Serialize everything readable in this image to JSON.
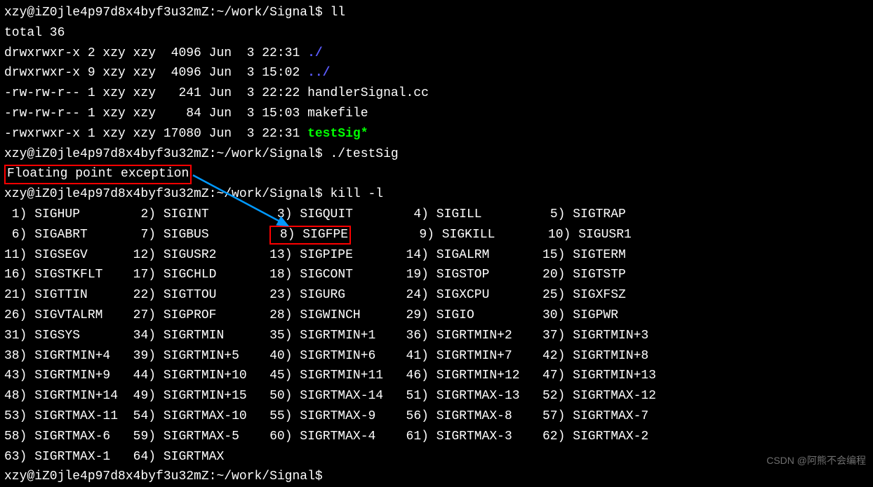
{
  "prompt": {
    "user": "xzy",
    "host": "iZ0jle4p97d8x4byf3u32mZ",
    "cwd": "~/work/Signal",
    "symbol": "$"
  },
  "commands": {
    "c1": "ll",
    "c2": "./testSig",
    "c3": "kill -l"
  },
  "ll_output": {
    "total": "total 36",
    "rows": [
      {
        "perm": "drwxrwxr-x",
        "links": "2",
        "owner": "xzy",
        "group": "xzy",
        "size": "4096",
        "date": "Jun  3 22:31",
        "name": "./",
        "class": "dir"
      },
      {
        "perm": "drwxrwxr-x",
        "links": "9",
        "owner": "xzy",
        "group": "xzy",
        "size": "4096",
        "date": "Jun  3 15:02",
        "name": "../",
        "class": "dir"
      },
      {
        "perm": "-rw-rw-r--",
        "links": "1",
        "owner": "xzy",
        "group": "xzy",
        "size": "241",
        "date": "Jun  3 22:22",
        "name": "handlerSignal.cc",
        "class": ""
      },
      {
        "perm": "-rw-rw-r--",
        "links": "1",
        "owner": "xzy",
        "group": "xzy",
        "size": "84",
        "date": "Jun  3 15:03",
        "name": "makefile",
        "class": ""
      },
      {
        "perm": "-rwxrwxr-x",
        "links": "1",
        "owner": "xzy",
        "group": "xzy",
        "size": "17080",
        "date": "Jun  3 22:31",
        "name": "testSig*",
        "class": "exec"
      }
    ]
  },
  "error_msg": "Floating point exception",
  "signals": [
    {
      "n": "1",
      "name": "SIGHUP"
    },
    {
      "n": "2",
      "name": "SIGINT"
    },
    {
      "n": "3",
      "name": "SIGQUIT"
    },
    {
      "n": "4",
      "name": "SIGILL"
    },
    {
      "n": "5",
      "name": "SIGTRAP"
    },
    {
      "n": "6",
      "name": "SIGABRT"
    },
    {
      "n": "7",
      "name": "SIGBUS"
    },
    {
      "n": "8",
      "name": "SIGFPE"
    },
    {
      "n": "9",
      "name": "SIGKILL"
    },
    {
      "n": "10",
      "name": "SIGUSR1"
    },
    {
      "n": "11",
      "name": "SIGSEGV"
    },
    {
      "n": "12",
      "name": "SIGUSR2"
    },
    {
      "n": "13",
      "name": "SIGPIPE"
    },
    {
      "n": "14",
      "name": "SIGALRM"
    },
    {
      "n": "15",
      "name": "SIGTERM"
    },
    {
      "n": "16",
      "name": "SIGSTKFLT"
    },
    {
      "n": "17",
      "name": "SIGCHLD"
    },
    {
      "n": "18",
      "name": "SIGCONT"
    },
    {
      "n": "19",
      "name": "SIGSTOP"
    },
    {
      "n": "20",
      "name": "SIGTSTP"
    },
    {
      "n": "21",
      "name": "SIGTTIN"
    },
    {
      "n": "22",
      "name": "SIGTTOU"
    },
    {
      "n": "23",
      "name": "SIGURG"
    },
    {
      "n": "24",
      "name": "SIGXCPU"
    },
    {
      "n": "25",
      "name": "SIGXFSZ"
    },
    {
      "n": "26",
      "name": "SIGVTALRM"
    },
    {
      "n": "27",
      "name": "SIGPROF"
    },
    {
      "n": "28",
      "name": "SIGWINCH"
    },
    {
      "n": "29",
      "name": "SIGIO"
    },
    {
      "n": "30",
      "name": "SIGPWR"
    },
    {
      "n": "31",
      "name": "SIGSYS"
    },
    {
      "n": "34",
      "name": "SIGRTMIN"
    },
    {
      "n": "35",
      "name": "SIGRTMIN+1"
    },
    {
      "n": "36",
      "name": "SIGRTMIN+2"
    },
    {
      "n": "37",
      "name": "SIGRTMIN+3"
    },
    {
      "n": "38",
      "name": "SIGRTMIN+4"
    },
    {
      "n": "39",
      "name": "SIGRTMIN+5"
    },
    {
      "n": "40",
      "name": "SIGRTMIN+6"
    },
    {
      "n": "41",
      "name": "SIGRTMIN+7"
    },
    {
      "n": "42",
      "name": "SIGRTMIN+8"
    },
    {
      "n": "43",
      "name": "SIGRTMIN+9"
    },
    {
      "n": "44",
      "name": "SIGRTMIN+10"
    },
    {
      "n": "45",
      "name": "SIGRTMIN+11"
    },
    {
      "n": "46",
      "name": "SIGRTMIN+12"
    },
    {
      "n": "47",
      "name": "SIGRTMIN+13"
    },
    {
      "n": "48",
      "name": "SIGRTMIN+14"
    },
    {
      "n": "49",
      "name": "SIGRTMIN+15"
    },
    {
      "n": "50",
      "name": "SIGRTMAX-14"
    },
    {
      "n": "51",
      "name": "SIGRTMAX-13"
    },
    {
      "n": "52",
      "name": "SIGRTMAX-12"
    },
    {
      "n": "53",
      "name": "SIGRTMAX-11"
    },
    {
      "n": "54",
      "name": "SIGRTMAX-10"
    },
    {
      "n": "55",
      "name": "SIGRTMAX-9"
    },
    {
      "n": "56",
      "name": "SIGRTMAX-8"
    },
    {
      "n": "57",
      "name": "SIGRTMAX-7"
    },
    {
      "n": "58",
      "name": "SIGRTMAX-6"
    },
    {
      "n": "59",
      "name": "SIGRTMAX-5"
    },
    {
      "n": "60",
      "name": "SIGRTMAX-4"
    },
    {
      "n": "61",
      "name": "SIGRTMAX-3"
    },
    {
      "n": "62",
      "name": "SIGRTMAX-2"
    },
    {
      "n": "63",
      "name": "SIGRTMAX-1"
    },
    {
      "n": "64",
      "name": "SIGRTMAX"
    }
  ],
  "highlight_signal": "8",
  "watermark": "CSDN @阿熊不会编程"
}
